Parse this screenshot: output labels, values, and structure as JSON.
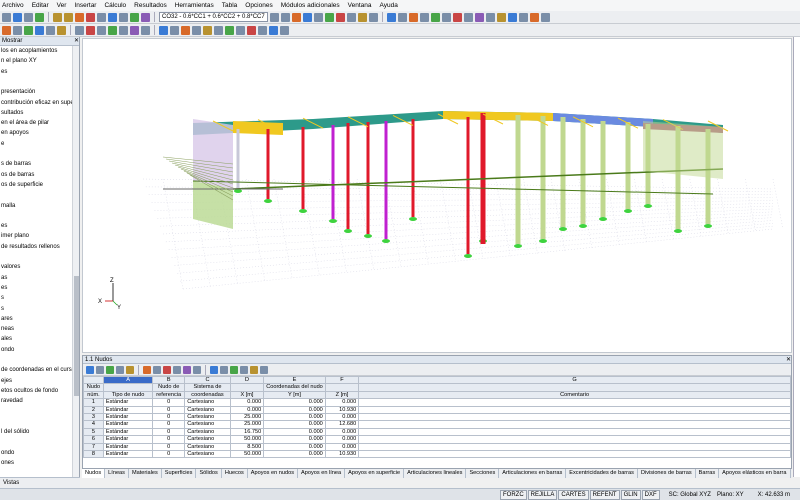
{
  "menu": [
    "Archivo",
    "Editar",
    "Ver",
    "Insertar",
    "Cálculo",
    "Resultados",
    "Herramientas",
    "Tabla",
    "Opciones",
    "Módulos adicionales",
    "Ventana",
    "Ayuda"
  ],
  "toolbar": {
    "load_combo": "CO32 - 0.6*CC1 + 0.6*CC2 + 0.8*CC7"
  },
  "navigator": {
    "title": "Mostrar",
    "items": [
      "los en acoplamientos",
      "n el plano XY",
      "es",
      "",
      "presentación",
      "contribución eficaz en superf",
      "sultados",
      "en el área de pilar",
      "en apoyos",
      "e",
      "",
      "s de barras",
      "os de barras",
      "os de superficie",
      "",
      "malla",
      "",
      "es",
      "imer plano",
      "de resultados rellenos",
      "",
      "valores",
      "as",
      "es",
      "s",
      "s",
      "ares",
      "neas",
      "ales",
      "ondo",
      "",
      "de coordenadas en el curs",
      "ejes",
      "etos ocultos de fondo",
      "ravedad",
      "",
      "",
      "l del sólido",
      "",
      "ondo",
      "ones"
    ],
    "footer": "Vistas"
  },
  "viewport": {
    "axis_x": "X",
    "axis_y": "Y",
    "axis_z": "Z"
  },
  "table": {
    "title": "1.1 Nudos",
    "columns": [
      {
        "letter": "",
        "h1": "Nudo",
        "h2": "núm."
      },
      {
        "letter": "A",
        "h1": "",
        "h2": "Tipo de nudo"
      },
      {
        "letter": "B",
        "h1": "Nudo de",
        "h2": "referencia"
      },
      {
        "letter": "C",
        "h1": "Sistema de",
        "h2": "coordenadas"
      },
      {
        "letter": "D",
        "h1": "",
        "h2": "X [m]"
      },
      {
        "letter": "E",
        "h1": "Coordenadas del nudo",
        "h2": "Y [m]"
      },
      {
        "letter": "F",
        "h1": "",
        "h2": "Z [m]"
      },
      {
        "letter": "G",
        "h1": "",
        "h2": "Comentario"
      }
    ],
    "rows": [
      [
        "1",
        "Estándar",
        "0",
        "Cartesiano",
        "0.000",
        "0.000",
        "0.000",
        ""
      ],
      [
        "2",
        "Estándar",
        "0",
        "Cartesiano",
        "0.000",
        "0.000",
        "10.930",
        ""
      ],
      [
        "3",
        "Estándar",
        "0",
        "Cartesiano",
        "25.000",
        "0.000",
        "0.000",
        ""
      ],
      [
        "4",
        "Estándar",
        "0",
        "Cartesiano",
        "25.000",
        "0.000",
        "12.680",
        ""
      ],
      [
        "5",
        "Estándar",
        "0",
        "Cartesiano",
        "16.750",
        "0.000",
        "0.000",
        ""
      ],
      [
        "6",
        "Estándar",
        "0",
        "Cartesiano",
        "50.000",
        "0.000",
        "0.000",
        ""
      ],
      [
        "7",
        "Estándar",
        "0",
        "Cartesiano",
        "8.500",
        "0.000",
        "0.000",
        ""
      ],
      [
        "8",
        "Estándar",
        "0",
        "Cartesiano",
        "50.000",
        "0.000",
        "10.930",
        ""
      ]
    ]
  },
  "sheet_tabs": [
    "Nudos",
    "Líneas",
    "Materiales",
    "Superficies",
    "Sólidos",
    "Huecos",
    "Apoyos en nudos",
    "Apoyos en línea",
    "Apoyos en superficie",
    "Articulaciones lineales",
    "Secciones",
    "Articulaciones en barras",
    "Excentricidades de barras",
    "Divisiones de barras",
    "Barras",
    "Apoyos elásticos en barra"
  ],
  "status": {
    "buttons": [
      "FORZC",
      "REJILLA",
      "CARTES",
      "REFENT",
      "GLIN",
      "DXF"
    ],
    "cs": "SC: Global XYZ",
    "plane": "Plano: XY",
    "coord": "X: 42.633 m"
  },
  "colors": {
    "column_red": "#e0192b",
    "column_magenta": "#c020d0",
    "roof_teal": "#2d9a8a",
    "support_green": "#3ed33e",
    "beam_green": "#4a7a1a"
  }
}
